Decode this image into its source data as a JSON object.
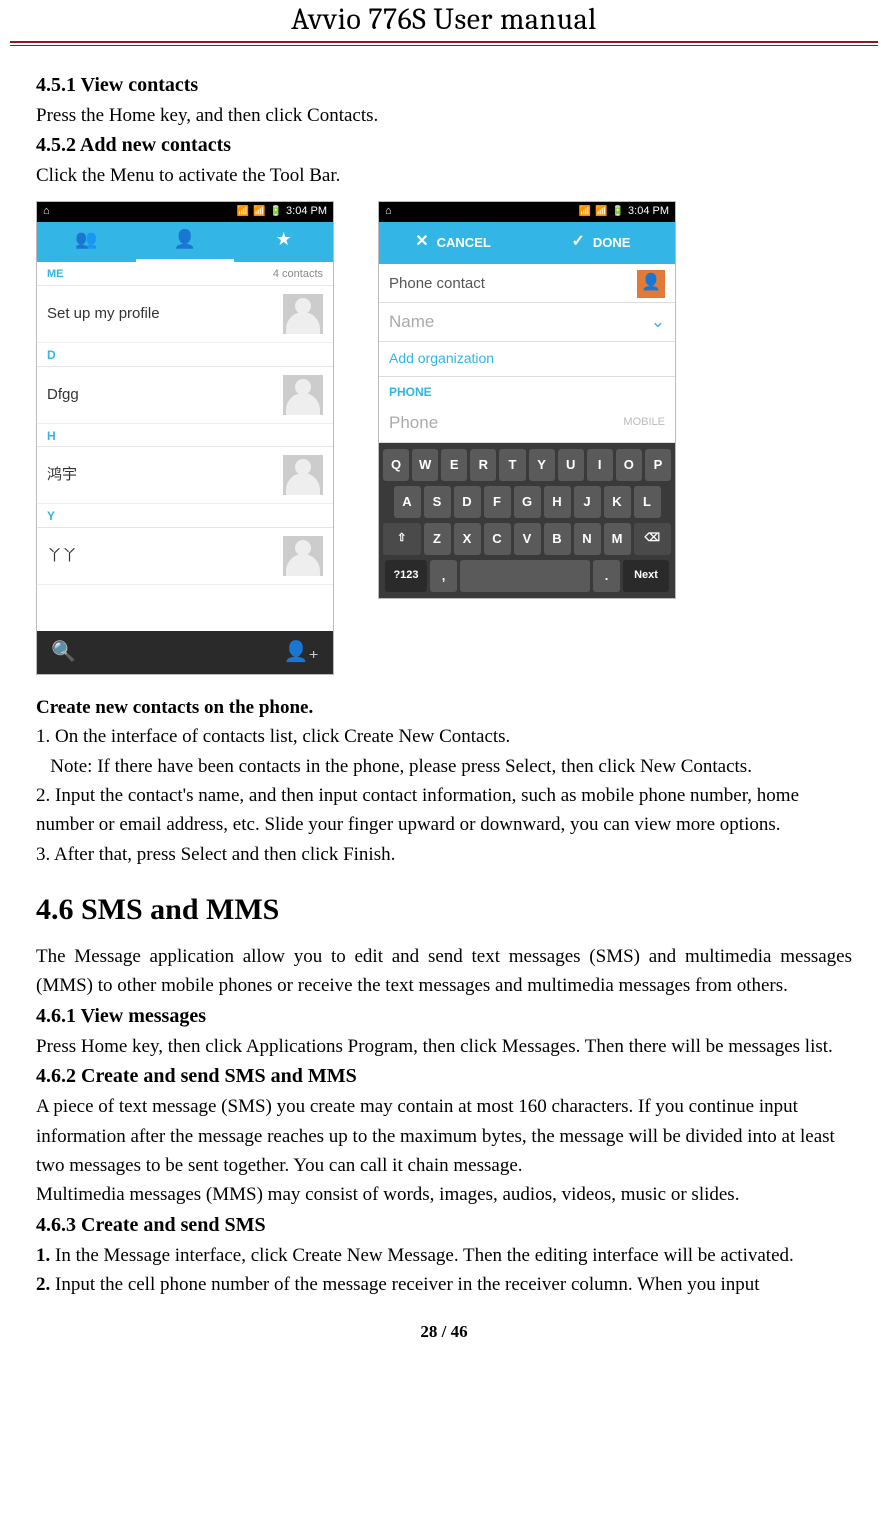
{
  "header": {
    "title": "Avvio 776S    User manual"
  },
  "sections": {
    "s451_h": "4.5.1 View contacts",
    "s451_t": "Press the Home key, and then click Contacts.",
    "s452_h": "4.5.2 Add new contacts",
    "s452_t": "Click the Menu to activate the Tool Bar.",
    "create_h": "Create new contacts on the phone.",
    "create_1": "1. On the interface of contacts list, click Create New Contacts.",
    "create_note": "   Note: If there have been contacts in the phone, please press Select, then click New Contacts.",
    "create_2": "2. Input the contact's name, and then input contact information, such as mobile phone number, home number or email address, etc. Slide your finger upward or downward, you can view more options.",
    "create_3": "3. After that, press Select and then click Finish.",
    "s46_h": "4.6 SMS and MMS",
    "s46_t": "The Message application allow you to edit and send text messages (SMS) and multimedia messages (MMS) to other mobile phones or receive the text messages and multimedia messages from others.",
    "s461_h": "4.6.1 View messages",
    "s461_t": "Press Home key, then click Applications Program, then click Messages. Then there will be messages list.",
    "s462_h": "4.6.2 Create and send SMS and MMS",
    "s462_t1": "A piece of text message (SMS) you create may contain at most 160 characters.  If you continue input information after the message reaches up to the maximum bytes, the message will be divided into at least two messages to be sent together. You can call it chain message.",
    "s462_t2": "Multimedia messages (MMS) may consist of words, images, audios, videos, music or slides.",
    "s463_h": "4.6.3 Create and send SMS",
    "s463_1a": "1.",
    "s463_1b": " In the Message interface, click Create New Message. Then the editing interface will be activated.",
    "s463_2a": "2.",
    "s463_2b": " Input the cell phone number of the message receiver in the receiver column. When you input"
  },
  "screenshot1": {
    "time": "3:04 PM",
    "tab_group": "👥",
    "tab_person": "👤",
    "tab_star": "★",
    "me": "ME",
    "count": "4 contacts",
    "setup": "Set up my profile",
    "hd_d": "D",
    "c1": "Dfgg",
    "hd_h": "H",
    "c2": "鸿宇",
    "hd_y": "Y",
    "c3": "丫丫",
    "search": "🔍",
    "add": "👤₊"
  },
  "screenshot2": {
    "time": "3:04 PM",
    "cancel": "CANCEL",
    "done": "DONE",
    "phone_contact": "Phone contact",
    "name_ph": "Name",
    "add_org": "Add organization",
    "phone_lbl": "PHONE",
    "phone_ph": "Phone",
    "mobile": "MOBILE",
    "keys_r1": [
      "Q",
      "W",
      "E",
      "R",
      "T",
      "Y",
      "U",
      "I",
      "O",
      "P"
    ],
    "keys_r2": [
      "A",
      "S",
      "D",
      "F",
      "G",
      "H",
      "J",
      "K",
      "L"
    ],
    "keys_r3": [
      "⇧",
      "Z",
      "X",
      "C",
      "V",
      "B",
      "N",
      "M",
      "⌫"
    ],
    "k_sym": "?123",
    "k_comma": ",",
    "k_dot": ".",
    "k_next": "Next"
  },
  "footer": {
    "page": "28 / 46"
  }
}
